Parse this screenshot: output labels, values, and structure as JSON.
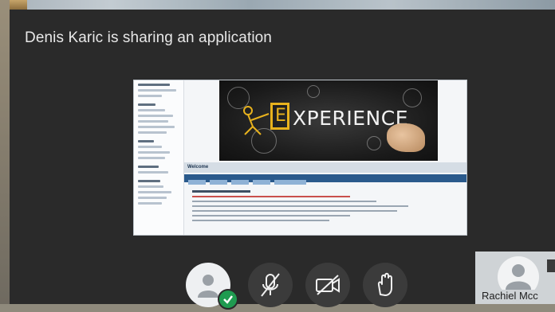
{
  "presentation": {
    "share_title": "Denis Karic is sharing an application"
  },
  "shared_app": {
    "banner_word": "XPERIENCE",
    "banner_letter": "E",
    "welcome_title": "Welcome"
  },
  "controls": [
    {
      "name": "participants-avatar",
      "icon": "user-icon"
    },
    {
      "name": "microphone-toggle",
      "icon": "mic-off-icon"
    },
    {
      "name": "camera-toggle",
      "icon": "camera-off-icon"
    },
    {
      "name": "raise-hand",
      "icon": "hand-icon"
    }
  ],
  "participant": {
    "name": "Rachiel Mcc"
  },
  "colors": {
    "background": "#2a2a2a",
    "accent_green": "#1f9b50",
    "control_dark": "#3b3b3b"
  }
}
